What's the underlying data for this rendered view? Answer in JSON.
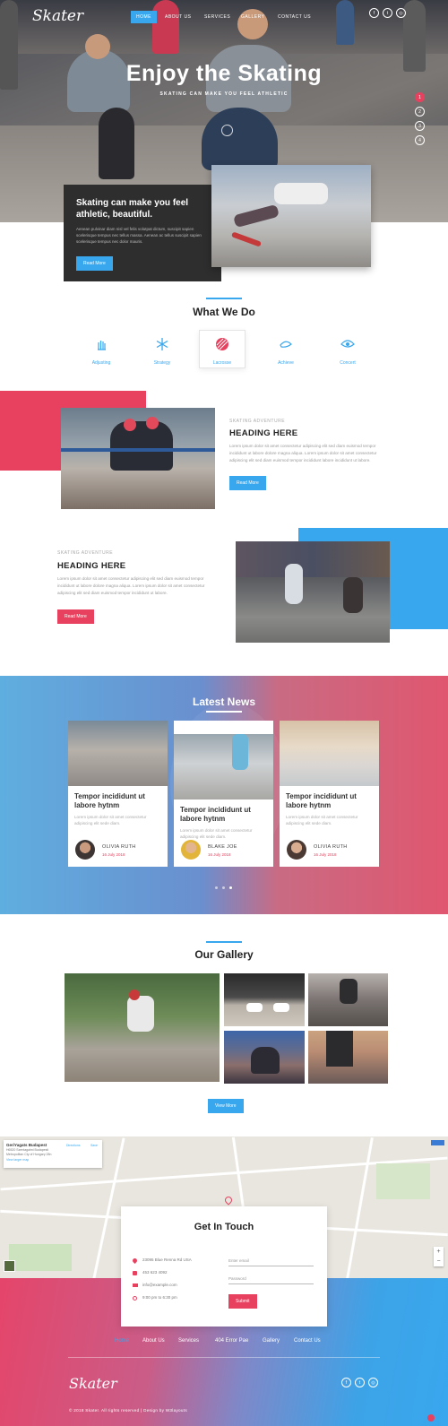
{
  "brand": {
    "logo_text": "Skater"
  },
  "nav": {
    "items": [
      "Home",
      "About Us",
      "Services",
      "Gallery",
      "Contact Us"
    ],
    "active_index": 0
  },
  "hero": {
    "title": "Enjoy the Skating",
    "subtitle": "SKATING CAN MAKE YOU FEEL ATHLETIC",
    "slides": [
      "1",
      "2",
      "3",
      "4"
    ],
    "card": {
      "title": "Skating can make you feel athletic, beautiful.",
      "text": "Aenean pulvinar diam nisl vel felis volutpat dictum, suscipit sapien scelerisque tempus nec tellus massa. Aenean ac tellus suscipit sapien scelerisque tempus nec dolor mauris.",
      "button": "Read More"
    }
  },
  "services": {
    "title": "What We Do",
    "items": [
      {
        "label": "Adjusting",
        "icon": "hand-icon"
      },
      {
        "label": "Strategy",
        "icon": "snowflake-icon"
      },
      {
        "label": "Lacrosse",
        "icon": "ball-icon"
      },
      {
        "label": "Achieve",
        "icon": "skate-icon"
      },
      {
        "label": "Concert",
        "icon": "eye-icon"
      }
    ]
  },
  "feature1": {
    "eyebrow": "SKATING ADVENTURE",
    "heading": "HEADING HERE",
    "text": "Lorem ipsum dolor sit amet consectetur adipiscing elit sed diam euismod tempor incididunt ut labore dolore magna aliqua. Lorem ipsum dolor sit amet consectetur adipiscing elit sed diam euismod tempor incididunt labore incididunt ut labore.",
    "button": "Read More"
  },
  "feature2": {
    "eyebrow": "SKATING ADVENTURE",
    "heading": "HEADING HERE",
    "text": "Lorem ipsum dolor sit amet consectetur adipiscing elit sed diam euismod tempor incididunt ut labore dolore magna aliqua. Lorem ipsum dolor sit amet consectetur adipiscing elit sed diam euismod tempor incididunt ut labore.",
    "button": "Read More"
  },
  "news": {
    "title": "Latest News",
    "cards": [
      {
        "title": "Tempor incididunt ut labore hytnm",
        "text": "Lorem ipsum dolor sit amet consectetur adipiscing elit sede diam.",
        "author": "OLIVIA RUTH",
        "date": "16 July 2018"
      },
      {
        "title": "Tempor incididunt ut labore hytnm",
        "text": "Lorem ipsum dolor sit amet consectetur adipiscing elit sede diam.",
        "author": "BLAKE JOE",
        "date": "16 July 2018"
      },
      {
        "title": "Tempor incididunt ut labore hytnm",
        "text": "Lorem ipsum dolor sit amet consectetur adipiscing elit sede diam.",
        "author": "OLIVIA RUTH",
        "date": "16 July 2018"
      }
    ]
  },
  "gallery": {
    "title": "Our Gallery",
    "button": "View More"
  },
  "map": {
    "place_name": "GeriYagats Budapest",
    "place_addr": "H6520 Szentagalmi Budapesti Metropolitan Cty of Hungary 28n",
    "larger_map": "View larger map",
    "directions": "Directions",
    "save": "Save"
  },
  "contact": {
    "title": "Get In Touch",
    "address": "23095 Blue Renna Rd USA",
    "phone": "453 623 4092",
    "email": "info@example.com",
    "hours": "9:00 pm to 6:30 pm",
    "name_placeholder": "Enter email",
    "password_placeholder": "Password",
    "submit": "Submit"
  },
  "footer": {
    "nav": [
      "Home",
      "About Us",
      "Services",
      "404 Error Pae",
      "Gallery",
      "Contact Us"
    ],
    "logo_text": "Skater",
    "copyright": "© 2018 Skater. All rights reserved | Design by W3layouts"
  },
  "colors": {
    "accent_blue": "#38a7ee",
    "accent_red": "#e8415f",
    "dark": "#2e2e2e"
  }
}
